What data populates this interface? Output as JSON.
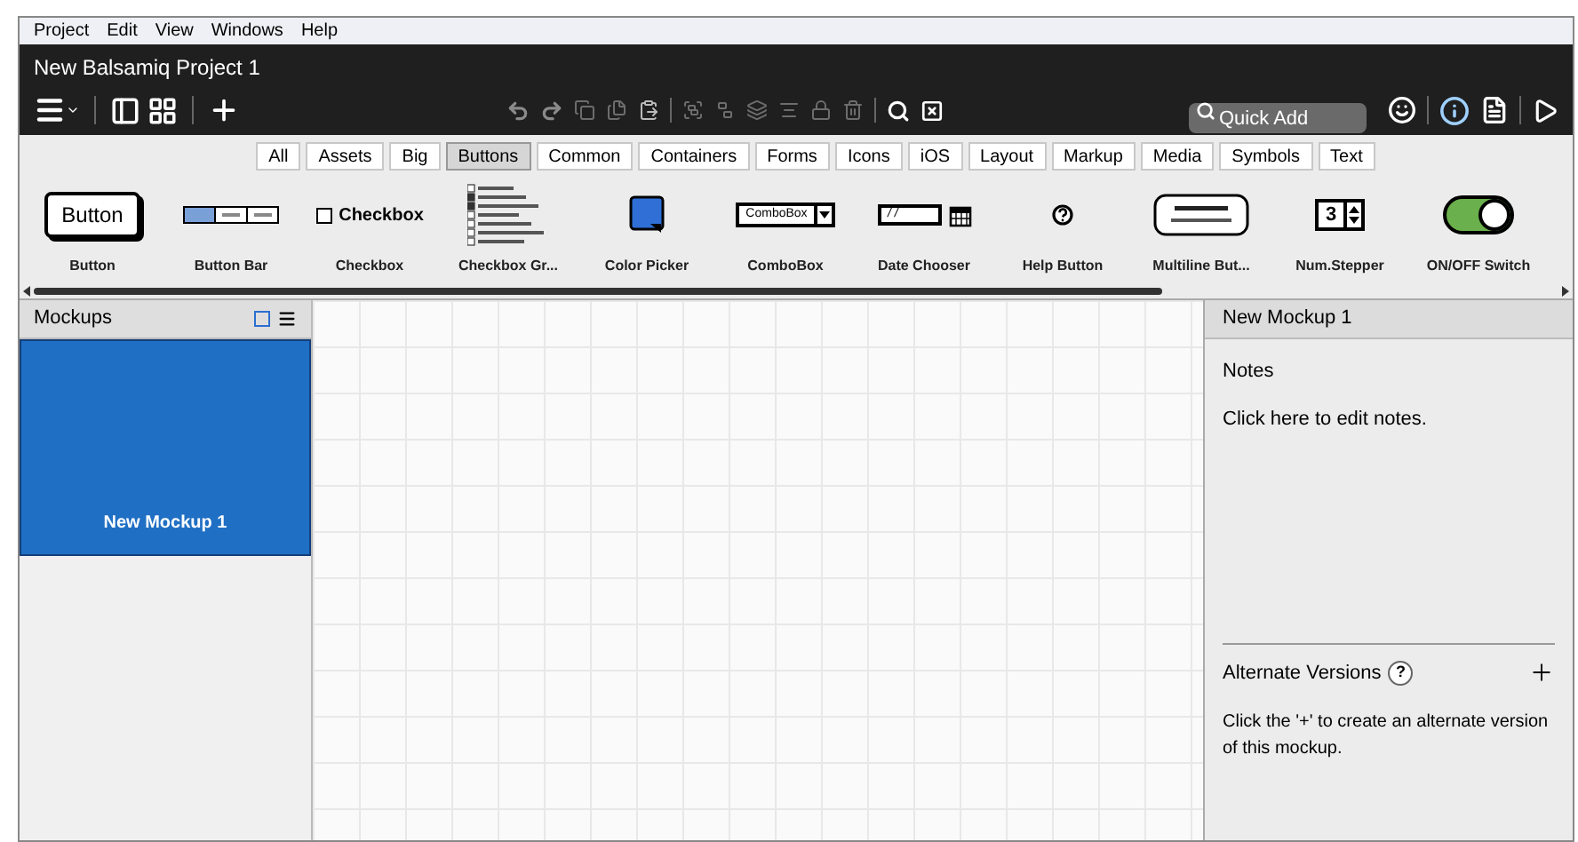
{
  "menu_bar": [
    "Project",
    "Edit",
    "View",
    "Windows",
    "Help"
  ],
  "window": {
    "title": "New Balsamiq Project 1"
  },
  "quick_add": {
    "placeholder": "Quick Add"
  },
  "library_tabs": [
    {
      "label": "All",
      "selected": false
    },
    {
      "label": "Assets",
      "selected": false
    },
    {
      "label": "Big",
      "selected": false
    },
    {
      "label": "Buttons",
      "selected": true
    },
    {
      "label": "Common",
      "selected": false
    },
    {
      "label": "Containers",
      "selected": false
    },
    {
      "label": "Forms",
      "selected": false
    },
    {
      "label": "Icons",
      "selected": false
    },
    {
      "label": "iOS",
      "selected": false
    },
    {
      "label": "Layout",
      "selected": false
    },
    {
      "label": "Markup",
      "selected": false
    },
    {
      "label": "Media",
      "selected": false
    },
    {
      "label": "Symbols",
      "selected": false
    },
    {
      "label": "Text",
      "selected": false
    }
  ],
  "library_items": [
    {
      "label": "Button",
      "kind": "button",
      "preview_text": "Button"
    },
    {
      "label": "Button Bar",
      "kind": "buttonbar"
    },
    {
      "label": "Checkbox",
      "kind": "checkbox",
      "preview_text": "Checkbox"
    },
    {
      "label": "Checkbox Gr...",
      "kind": "checkboxgroup"
    },
    {
      "label": "Color Picker",
      "kind": "colorpicker",
      "color": "#2f6fd6"
    },
    {
      "label": "ComboBox",
      "kind": "combobox",
      "preview_text": "ComboBox"
    },
    {
      "label": "Date Chooser",
      "kind": "date",
      "preview_text": "/ /"
    },
    {
      "label": "Help Button",
      "kind": "help"
    },
    {
      "label": "Multiline But...",
      "kind": "multiline"
    },
    {
      "label": "Num.Stepper",
      "kind": "stepper",
      "preview_text": "3"
    },
    {
      "label": "ON/OFF Switch",
      "kind": "switch",
      "on": true
    }
  ],
  "mockups_panel": {
    "title": "Mockups",
    "items": [
      {
        "label": "New Mockup 1",
        "selected": true
      }
    ]
  },
  "details_panel": {
    "title": "New Mockup 1",
    "notes_heading": "Notes",
    "notes_text": "Click here to edit notes.",
    "versions_heading": "Alternate Versions",
    "versions_help": "?",
    "versions_text": "Click the '+' to create an alternate version of this mockup."
  }
}
